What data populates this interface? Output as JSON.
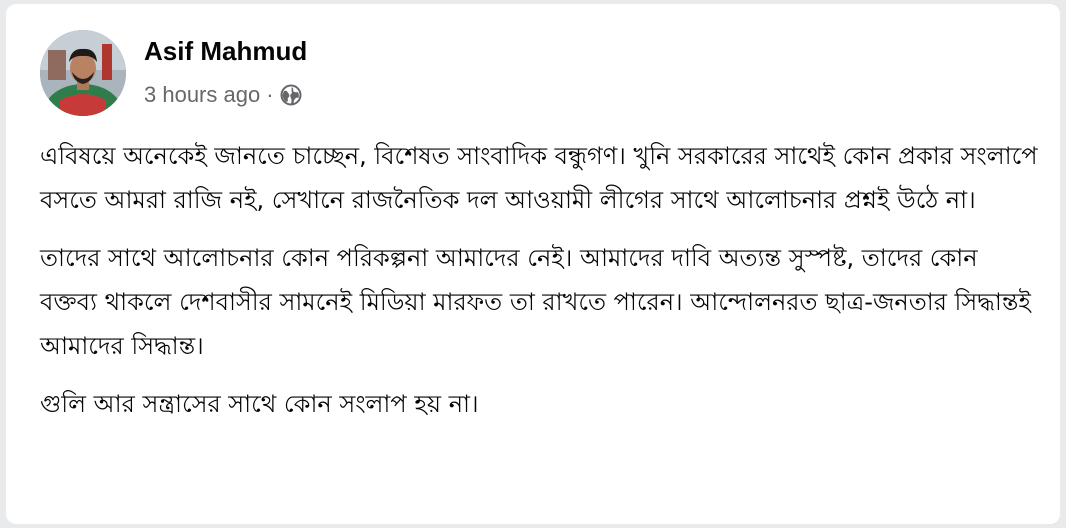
{
  "post": {
    "author": "Asif Mahmud",
    "timestamp": "3 hours ago",
    "separator": "·",
    "privacy_icon": "globe-icon",
    "paragraphs": [
      "এবিষয়ে অনেকেই জানতে চাচ্ছেন, বিশেষত সাংবাদিক বন্ধুগণ। খুনি সরকারের সাথেই কোন প্রকার সংলাপে বসতে আমরা রাজি নই, সেখানে রাজনৈতিক দল আওয়ামী লীগের সাথে আলোচনার প্রশ্নই উঠে না।",
      "তাদের সাথে আলোচনার কোন পরিকল্পনা আমাদের নেই। আমাদের দাবি অত্যন্ত সুস্পষ্ট, তাদের কোন বক্তব্য থাকলে দেশবাসীর সামনেই মিডিয়া মারফত তা রাখতে পারেন। আন্দোলনরত ছাত্র-জনতার সিদ্ধান্তই আমাদের সিদ্ধান্ত।",
      "গুলি আর সন্ত্রাসের সাথে কোন সংলাপ হয় না।"
    ]
  },
  "colors": {
    "page_bg": "#e9eaec",
    "card_bg": "#ffffff",
    "text_primary": "#050505",
    "text_secondary": "#65676b"
  }
}
